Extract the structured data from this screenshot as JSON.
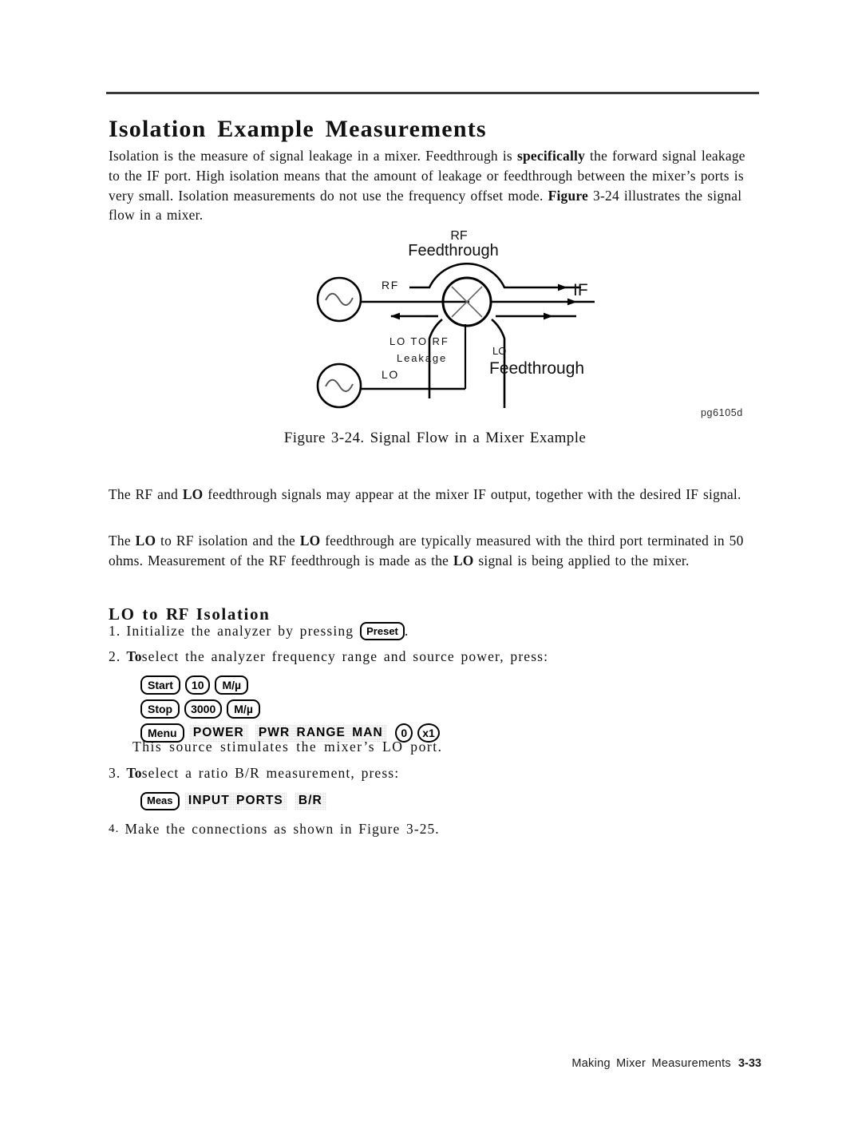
{
  "document": {
    "title": "Isolation Example Measurements",
    "intro_paragraph": {
      "part1": "Isolation is the measure of signal leakage in a mixer. Feedthrough is ",
      "bold1": "specifically",
      "part2": " the forward signal leakage to the IF port. High isolation means that the amount of leakage or feedthrough between the mixer’s ports is very small. Isolation measurements do not use the frequency offset mode. ",
      "bold2": "Figure",
      "part3": " 3-24 illustrates the signal flow in a mixer."
    },
    "figure": {
      "id_code": "pg6105d",
      "caption": "Figure 3-24. Signal Flow in a Mixer Example",
      "labels": {
        "source_rf": "RF",
        "source_lo": "LO",
        "port_rf": "RF",
        "port_lo": "LO",
        "output_if": "IF",
        "rf_feedthrough_top": "RF",
        "rf_feedthrough_main": "Feedthrough",
        "lo_feedthrough_top": "LO",
        "lo_feedthrough_main": "Feedthrough",
        "leakage_line1": "LO TO RF",
        "leakage_line2": "Leakage"
      }
    },
    "para_rf_lo": {
      "part1": "The RF and ",
      "bold1": "LO",
      "part2": " feedthrough signals may appear at the mixer IF output, together with the desired IF signal."
    },
    "para_lo_rf_iso": {
      "part1": "The ",
      "bold1": "LO",
      "part2": " to RF isolation and the ",
      "bold2": "LO",
      "part3": " feedthrough are typically measured with the third port terminated in 50 ohms. Measurement of the RF feedthrough is made as the ",
      "bold3": "LO",
      "part4": " signal is being applied to the mixer."
    },
    "section_heading": {
      "part1": "LO to ",
      "bold1": "RF",
      "part2": " Isolation"
    },
    "steps": {
      "step1": {
        "num": "1.",
        "text_before": "Initialize the analyzer by pressing",
        "key": "Preset",
        "text_after": "."
      },
      "step2": {
        "num": "2.",
        "bold_lead": "To",
        "text": " select the analyzer frequency range and source power, press:"
      },
      "note": "This source stimulates the mixer’s LO port.",
      "step3": {
        "num": "3.",
        "bold_lead": "To",
        "text": " select a ratio B/R measurement, press:"
      },
      "step4": {
        "num": "4.",
        "text": "Make the connections as shown in Figure 3-25."
      }
    },
    "key_sequences": {
      "frequency_power": [
        {
          "keys": [
            "Start",
            "10",
            "M/µ"
          ],
          "softkeys": []
        },
        {
          "keys": [
            "Stop",
            "3000",
            "M/µ"
          ],
          "softkeys": []
        },
        {
          "keys": [
            "Menu"
          ],
          "softkeys": [
            "POWER",
            "PWR RANGE MAN"
          ],
          "trailing_keys": [
            "0",
            "x1"
          ]
        }
      ],
      "measurement": [
        {
          "keys": [
            "Meas"
          ],
          "softkeys": [
            "INPUT PORTS",
            "B/R"
          ]
        }
      ]
    },
    "footer": {
      "chapter": "Making Mixer Measurements",
      "page": "3-33"
    },
    "colors": {
      "ink": "#111111",
      "rule": "#3a3a3a",
      "softkey_bg": "#d9d9d9",
      "paper": "#ffffff"
    }
  }
}
